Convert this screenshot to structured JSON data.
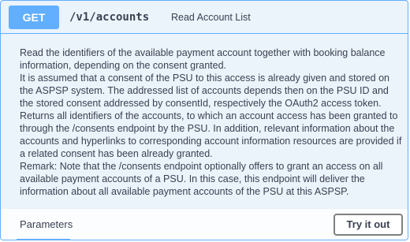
{
  "operation": {
    "method": "GET",
    "path": "/v1/accounts",
    "summary": "Read Account List",
    "method_color": "#61affe"
  },
  "description": [
    "Read the identifiers of the available payment account together with booking balance information, depending on the consent granted.",
    "It is assumed that a consent of the PSU to this access is already given and stored on the ASPSP system. The addressed list of accounts depends then on the PSU ID and the stored consent addressed by consentId, respectively the OAuth2 access token.",
    "Returns all identifiers of the accounts, to which an account access has been granted to through the /consents endpoint by the PSU. In addition, relevant information about the accounts and hyperlinks to corresponding account information resources are provided if a related consent has been already granted.",
    "Remark: Note that the /consents endpoint optionally offers to grant an access on all available payment accounts of a PSU. In this case, this endpoint will deliver the information about all available payment accounts of the PSU at this ASPSP."
  ],
  "parameters": {
    "tab_label": "Parameters",
    "try_button_label": "Try it out"
  }
}
